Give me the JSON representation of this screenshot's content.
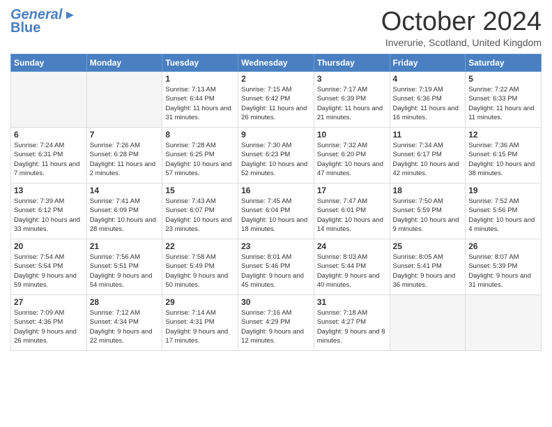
{
  "header": {
    "logo_general": "General",
    "logo_blue": "Blue",
    "title": "October 2024",
    "location": "Inverurie, Scotland, United Kingdom"
  },
  "days_of_week": [
    "Sunday",
    "Monday",
    "Tuesday",
    "Wednesday",
    "Thursday",
    "Friday",
    "Saturday"
  ],
  "weeks": [
    [
      {
        "num": "",
        "info": ""
      },
      {
        "num": "",
        "info": ""
      },
      {
        "num": "1",
        "info": "Sunrise: 7:13 AM\nSunset: 6:44 PM\nDaylight: 11 hours and 31 minutes."
      },
      {
        "num": "2",
        "info": "Sunrise: 7:15 AM\nSunset: 6:42 PM\nDaylight: 11 hours and 26 minutes."
      },
      {
        "num": "3",
        "info": "Sunrise: 7:17 AM\nSunset: 6:39 PM\nDaylight: 11 hours and 21 minutes."
      },
      {
        "num": "4",
        "info": "Sunrise: 7:19 AM\nSunset: 6:36 PM\nDaylight: 11 hours and 16 minutes."
      },
      {
        "num": "5",
        "info": "Sunrise: 7:22 AM\nSunset: 6:33 PM\nDaylight: 11 hours and 11 minutes."
      }
    ],
    [
      {
        "num": "6",
        "info": "Sunrise: 7:24 AM\nSunset: 6:31 PM\nDaylight: 11 hours and 7 minutes."
      },
      {
        "num": "7",
        "info": "Sunrise: 7:26 AM\nSunset: 6:28 PM\nDaylight: 11 hours and 2 minutes."
      },
      {
        "num": "8",
        "info": "Sunrise: 7:28 AM\nSunset: 6:25 PM\nDaylight: 10 hours and 57 minutes."
      },
      {
        "num": "9",
        "info": "Sunrise: 7:30 AM\nSunset: 6:23 PM\nDaylight: 10 hours and 52 minutes."
      },
      {
        "num": "10",
        "info": "Sunrise: 7:32 AM\nSunset: 6:20 PM\nDaylight: 10 hours and 47 minutes."
      },
      {
        "num": "11",
        "info": "Sunrise: 7:34 AM\nSunset: 6:17 PM\nDaylight: 10 hours and 42 minutes."
      },
      {
        "num": "12",
        "info": "Sunrise: 7:36 AM\nSunset: 6:15 PM\nDaylight: 10 hours and 38 minutes."
      }
    ],
    [
      {
        "num": "13",
        "info": "Sunrise: 7:39 AM\nSunset: 6:12 PM\nDaylight: 10 hours and 33 minutes."
      },
      {
        "num": "14",
        "info": "Sunrise: 7:41 AM\nSunset: 6:09 PM\nDaylight: 10 hours and 28 minutes."
      },
      {
        "num": "15",
        "info": "Sunrise: 7:43 AM\nSunset: 6:07 PM\nDaylight: 10 hours and 23 minutes."
      },
      {
        "num": "16",
        "info": "Sunrise: 7:45 AM\nSunset: 6:04 PM\nDaylight: 10 hours and 18 minutes."
      },
      {
        "num": "17",
        "info": "Sunrise: 7:47 AM\nSunset: 6:01 PM\nDaylight: 10 hours and 14 minutes."
      },
      {
        "num": "18",
        "info": "Sunrise: 7:50 AM\nSunset: 5:59 PM\nDaylight: 10 hours and 9 minutes."
      },
      {
        "num": "19",
        "info": "Sunrise: 7:52 AM\nSunset: 5:56 PM\nDaylight: 10 hours and 4 minutes."
      }
    ],
    [
      {
        "num": "20",
        "info": "Sunrise: 7:54 AM\nSunset: 5:54 PM\nDaylight: 9 hours and 59 minutes."
      },
      {
        "num": "21",
        "info": "Sunrise: 7:56 AM\nSunset: 5:51 PM\nDaylight: 9 hours and 54 minutes."
      },
      {
        "num": "22",
        "info": "Sunrise: 7:58 AM\nSunset: 5:49 PM\nDaylight: 9 hours and 50 minutes."
      },
      {
        "num": "23",
        "info": "Sunrise: 8:01 AM\nSunset: 5:46 PM\nDaylight: 9 hours and 45 minutes."
      },
      {
        "num": "24",
        "info": "Sunrise: 8:03 AM\nSunset: 5:44 PM\nDaylight: 9 hours and 40 minutes."
      },
      {
        "num": "25",
        "info": "Sunrise: 8:05 AM\nSunset: 5:41 PM\nDaylight: 9 hours and 36 minutes."
      },
      {
        "num": "26",
        "info": "Sunrise: 8:07 AM\nSunset: 5:39 PM\nDaylight: 9 hours and 31 minutes."
      }
    ],
    [
      {
        "num": "27",
        "info": "Sunrise: 7:09 AM\nSunset: 4:36 PM\nDaylight: 9 hours and 26 minutes."
      },
      {
        "num": "28",
        "info": "Sunrise: 7:12 AM\nSunset: 4:34 PM\nDaylight: 9 hours and 22 minutes."
      },
      {
        "num": "29",
        "info": "Sunrise: 7:14 AM\nSunset: 4:31 PM\nDaylight: 9 hours and 17 minutes."
      },
      {
        "num": "30",
        "info": "Sunrise: 7:16 AM\nSunset: 4:29 PM\nDaylight: 9 hours and 12 minutes."
      },
      {
        "num": "31",
        "info": "Sunrise: 7:18 AM\nSunset: 4:27 PM\nDaylight: 9 hours and 8 minutes."
      },
      {
        "num": "",
        "info": ""
      },
      {
        "num": "",
        "info": ""
      }
    ]
  ]
}
